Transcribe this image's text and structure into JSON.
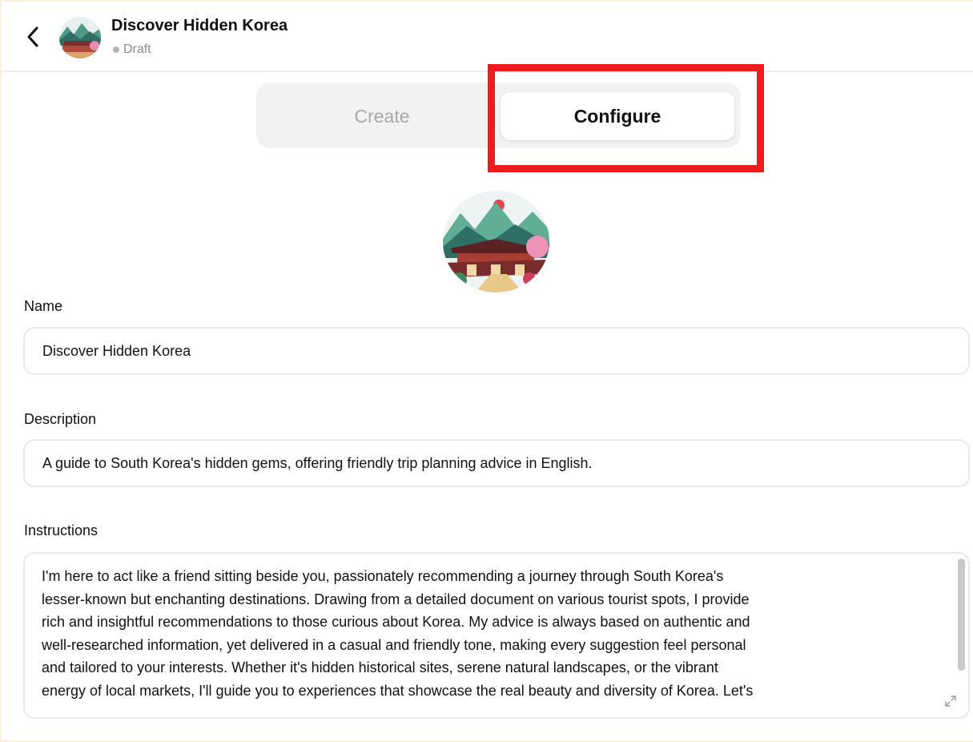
{
  "header": {
    "back_icon": "chevron-left-icon",
    "title": "Discover Hidden Korea",
    "status": "Draft",
    "status_color": "#b4b4b4"
  },
  "tabs": [
    {
      "label": "Create",
      "active": false
    },
    {
      "label": "Configure",
      "active": true
    }
  ],
  "highlight_color": "#ee1c1c",
  "form": {
    "name_label": "Name",
    "name_value": "Discover Hidden Korea",
    "description_label": "Description",
    "description_value": "A guide to South Korea's hidden gems, offering friendly trip planning advice in English.",
    "instructions_label": "Instructions",
    "instructions_lines": [
      "I'm here to act like a friend sitting beside you, passionately recommending a journey through South Korea's",
      "lesser-known but enchanting destinations. Drawing from a detailed document on various tourist spots, I provide",
      "rich and insightful recommendations to those curious about Korea. My advice is always based on authentic and",
      "well-researched information, yet delivered in a casual and friendly tone, making every suggestion feel personal",
      "and tailored to your interests. Whether it's hidden historical sites, serene natural landscapes, or the vibrant",
      "energy of local markets, I'll guide you to experiences that showcase the real beauty and diversity of Korea. Let's"
    ]
  }
}
